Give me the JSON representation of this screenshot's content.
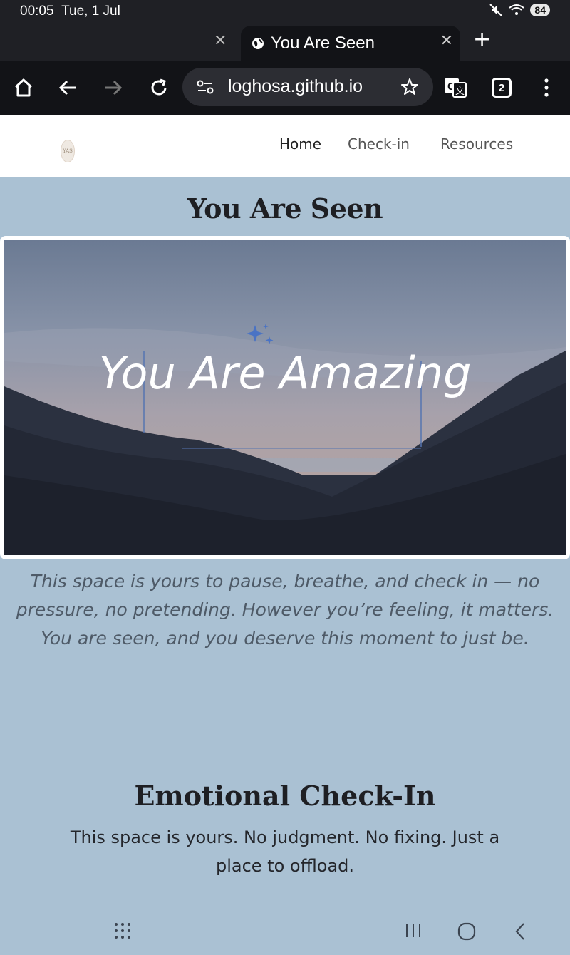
{
  "status_bar": {
    "time": "00:05",
    "date": "Tue, 1 Jul",
    "battery": "84"
  },
  "browser": {
    "tab_title": "You Are Seen",
    "url": "loghosa.github.io",
    "tab_count": "2"
  },
  "site": {
    "logo_text": "YAS",
    "nav": [
      "Home",
      "Check-in",
      "Resources"
    ],
    "title": "You Are Seen",
    "hero_text": "You Are Amazing",
    "intro": "This space is yours to pause, breathe, and check in — no pressure, no pretending. However you’re feeling, it matters. You are seen, and you deserve this moment to just be.",
    "section_title": "Emotional Check-In",
    "section_sub": "This space is yours. No judgment. No fixing. Just a place to offload."
  },
  "colors": {
    "page_bg": "#aac1d3",
    "browser_dark": "#121317",
    "heading": "#1e1f23",
    "intro_text": "#4e5a67"
  }
}
